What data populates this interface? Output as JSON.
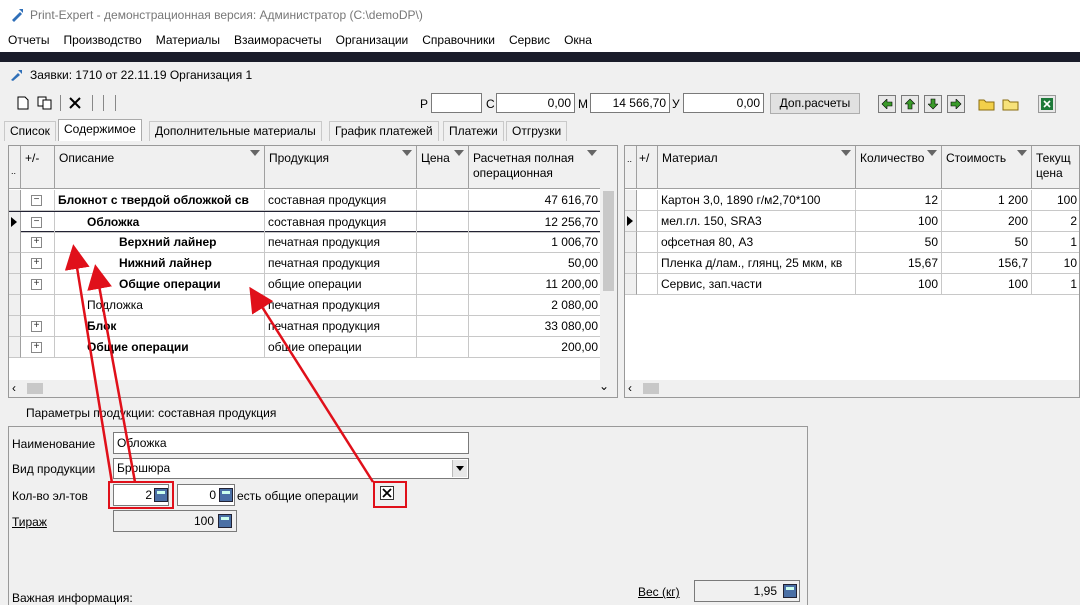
{
  "window": {
    "title": "Print-Expert - демонстрационная версия: Администратор (C:\\demoDP\\)"
  },
  "menu": [
    "Отчеты",
    "Производство",
    "Материалы",
    "Взаиморасчеты",
    "Организации",
    "Справочники",
    "Сервис",
    "Окна"
  ],
  "document": {
    "title": "Заявки: 1710 от 22.11.19  Организация 1"
  },
  "toolbar": {
    "p_label": "Р",
    "p_value": "",
    "c_label": "С",
    "c_value": "0,00",
    "m_label": "М",
    "m_value": "14 566,70",
    "u_label": "У",
    "u_value": "0,00",
    "calc_button": "Доп.расчеты"
  },
  "tabs": [
    "Список",
    "Содержимое",
    "Дополнительные материалы",
    "График платежей",
    "Платежи",
    "Отгрузки"
  ],
  "active_tab": 1,
  "left_grid": {
    "headers": {
      "indicator": "..",
      "pm": "+/-",
      "description": "Описание",
      "product": "Продукция",
      "price": "Цена",
      "calc": "Расчетная полная операционная"
    },
    "rows": [
      {
        "pm": "−",
        "desc": "Блокнот с твердой обложкой св",
        "product": "составная продукция",
        "calc": "47 616,70"
      },
      {
        "pm": "−",
        "desc": "Обложка",
        "product": "составная продукция",
        "calc": "12 256,70"
      },
      {
        "pm": "+",
        "desc": "Верхний лайнер",
        "product": "печатная продукция",
        "calc": "1 006,70"
      },
      {
        "pm": "+",
        "desc": "Нижний лайнер",
        "product": "печатная продукция",
        "calc": "50,00"
      },
      {
        "pm": "+",
        "desc": "Общие операции",
        "product": "общие операции",
        "calc": "11 200,00"
      },
      {
        "pm": "",
        "desc": "Подложка",
        "product": "печатная продукция",
        "calc": "2 080,00"
      },
      {
        "pm": "+",
        "desc": "Блок",
        "product": "печатная продукция",
        "calc": "33 080,00"
      },
      {
        "pm": "+",
        "desc": "Общие операции",
        "product": "общие операции",
        "calc": "200,00"
      }
    ]
  },
  "right_grid": {
    "headers": {
      "indicator": "..",
      "pm": "+/",
      "material": "Материал",
      "qty": "Количество",
      "cost": "Стоимость",
      "current": "Текущ цена"
    },
    "rows": [
      {
        "material": "Картон 3,0, 1890 г/м2,70*100",
        "qty": "12",
        "cost": "1 200",
        "current": "100"
      },
      {
        "material": "мел.гл. 150, SRA3",
        "qty": "100",
        "cost": "200",
        "current": "2"
      },
      {
        "material": "офсетная 80, А3",
        "qty": "50",
        "cost": "50",
        "current": "1"
      },
      {
        "material": "Пленка д/лам., глянц, 25 мкм, кв",
        "qty": "15,67",
        "cost": "156,7",
        "current": "10"
      },
      {
        "material": "Сервис, зап.части",
        "qty": "100",
        "cost": "100",
        "current": "1"
      }
    ]
  },
  "params": {
    "header": "Параметры продукции: составная продукция",
    "name_label": "Наименование",
    "name_value": "Обложка",
    "type_label": "Вид продукции",
    "type_value": "Брошюра",
    "count_label": "Кол-во эл-тов",
    "count_value": "2",
    "count2_value": "0",
    "common_ops_label": "есть общие операции",
    "common_ops_checked": true,
    "print_run_label": "Тираж",
    "print_run_value": "100",
    "weight_label": "Вес (кг)",
    "weight_value": "1,95",
    "important_label": "Важная информация:"
  }
}
